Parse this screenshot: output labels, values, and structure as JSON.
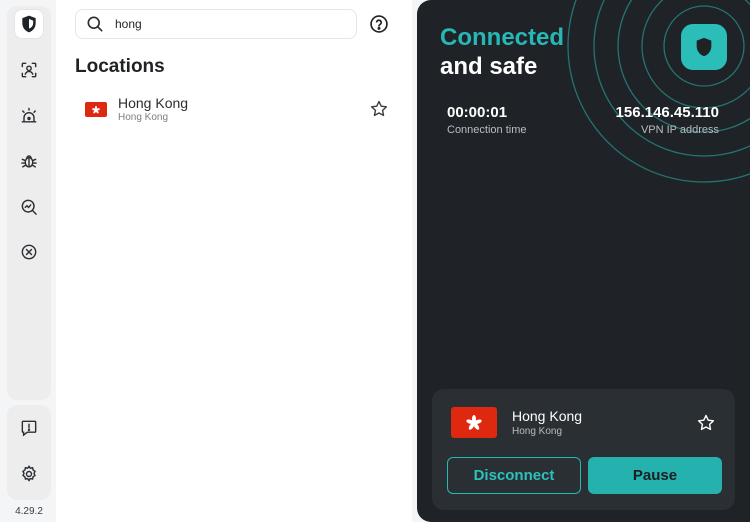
{
  "sidebar": {
    "items": [
      {
        "icon": "shield-icon",
        "active": true
      },
      {
        "icon": "user-scan-icon",
        "active": false
      },
      {
        "icon": "alarm-icon",
        "active": false
      },
      {
        "icon": "bug-icon",
        "active": false
      },
      {
        "icon": "magnify-chart-icon",
        "active": false
      },
      {
        "icon": "block-icon",
        "active": false
      }
    ],
    "bottom_items": [
      {
        "icon": "feedback-icon"
      },
      {
        "icon": "gear-icon"
      }
    ],
    "version": "4.29.2"
  },
  "search": {
    "value": "hong",
    "placeholder": "Search"
  },
  "locations": {
    "title": "Locations",
    "results": [
      {
        "name": "Hong Kong",
        "sub": "Hong Kong",
        "flag": "hk-flag-icon",
        "starred": false
      }
    ]
  },
  "connection": {
    "status_line1": "Connected",
    "status_line2": "and safe",
    "time_value": "00:00:01",
    "time_label": "Connection time",
    "ip_value": "156.146.45.110",
    "ip_label": "VPN IP address",
    "current_location": {
      "name": "Hong Kong",
      "sub": "Hong Kong"
    },
    "disconnect_label": "Disconnect",
    "pause_label": "Pause"
  },
  "colors": {
    "accent": "#27b7b4",
    "panel_dark": "#1f2327",
    "card_dark": "#2a2f34",
    "hk_red": "#de2910"
  }
}
